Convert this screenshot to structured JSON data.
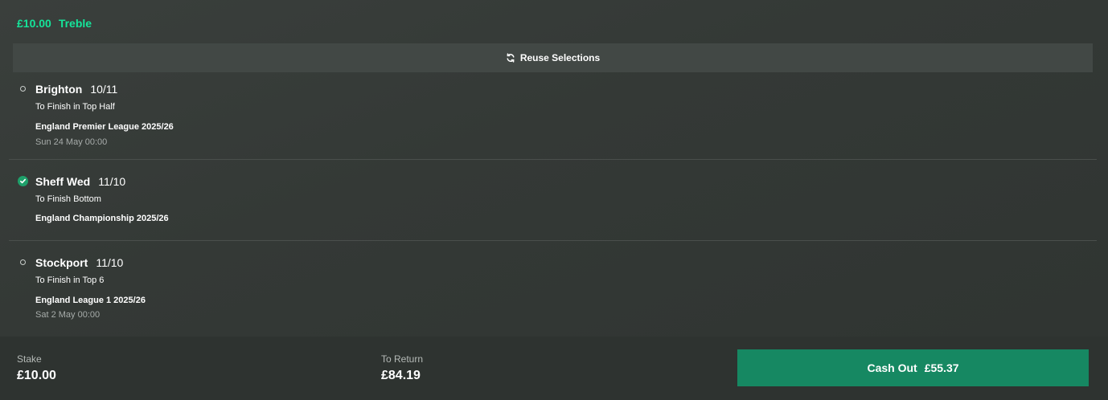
{
  "bet": {
    "stake_label": "£10.00",
    "type": "Treble"
  },
  "reuse": {
    "label": "Reuse Selections",
    "icon": "refresh-icon"
  },
  "selections": [
    {
      "name": "Brighton",
      "odds": "10/11",
      "market": "To Finish in Top Half",
      "event": "England Premier League 2025/26",
      "date": "Sun 24 May 00:00",
      "status": "open"
    },
    {
      "name": "Sheff Wed",
      "odds": "11/10",
      "market": "To Finish Bottom",
      "event": "England Championship 2025/26",
      "date": "",
      "status": "won"
    },
    {
      "name": "Stockport",
      "odds": "11/10",
      "market": "To Finish in Top 6",
      "event": "England League 1 2025/26",
      "date": "Sat 2 May 00:00",
      "status": "open"
    }
  ],
  "footer": {
    "stake_label": "Stake",
    "stake_value": "£10.00",
    "return_label": "To Return",
    "return_value": "£84.19",
    "cashout_label": "Cash Out",
    "cashout_value": "£55.37"
  },
  "colors": {
    "accent_green": "#15e49a",
    "cashout_button": "#168862",
    "won_badge": "#1ea06a",
    "background": "#343936"
  }
}
